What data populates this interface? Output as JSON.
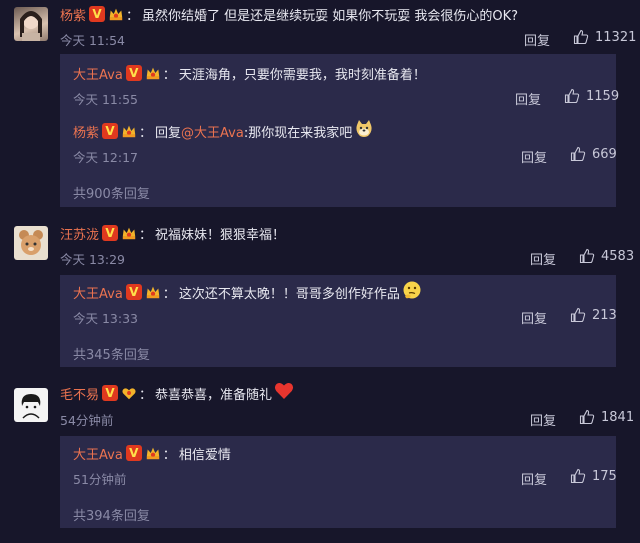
{
  "comments": [
    {
      "user": "杨紫",
      "text": "虽然你结婚了 但是还是继续玩耍 如果你不玩耍 我会很伤心的OK?",
      "time": "今天 11:54",
      "reply_label": "回复",
      "likes": "11321",
      "replies": [
        {
          "user": "大王Ava",
          "text": "天涯海角，只要你需要我，我时刻准备着！",
          "time": "今天 11:55",
          "reply_label": "回复",
          "likes": "1159"
        },
        {
          "user": "杨紫",
          "reply_prefix": "回复",
          "mention": "@大王Ava",
          "text": ":那你现在来我家吧",
          "emoji": "doge-emoji",
          "time": "今天 12:17",
          "reply_label": "回复",
          "likes": "669"
        }
      ],
      "total": "共900条回复"
    },
    {
      "user": "汪苏泷",
      "text": "祝福妹妹！狠狠幸福！",
      "time": "今天 13:29",
      "reply_label": "回复",
      "likes": "4583",
      "replies": [
        {
          "user": "大王Ava",
          "text": "这次还不算太晚！！哥哥多创作好作品",
          "emoji": "thinking-emoji",
          "time": "今天 13:33",
          "reply_label": "回复",
          "likes": "213"
        }
      ],
      "total": "共345条回复"
    },
    {
      "user": "毛不易",
      "text": "恭喜恭喜，准备随礼",
      "emoji": "heart-emoji",
      "time": "54分钟前",
      "reply_label": "回复",
      "likes": "1841",
      "replies": [
        {
          "user": "大王Ava",
          "text": "相信爱情",
          "time": "51分钟前",
          "reply_label": "回复",
          "likes": "175"
        }
      ],
      "total": "共394条回复"
    }
  ],
  "badges": {
    "verified": "V"
  },
  "colors": {
    "background": "#17162a",
    "reply_box": "#2b2a4a",
    "username": "#eb7350",
    "meta": "#8a8aa6"
  }
}
